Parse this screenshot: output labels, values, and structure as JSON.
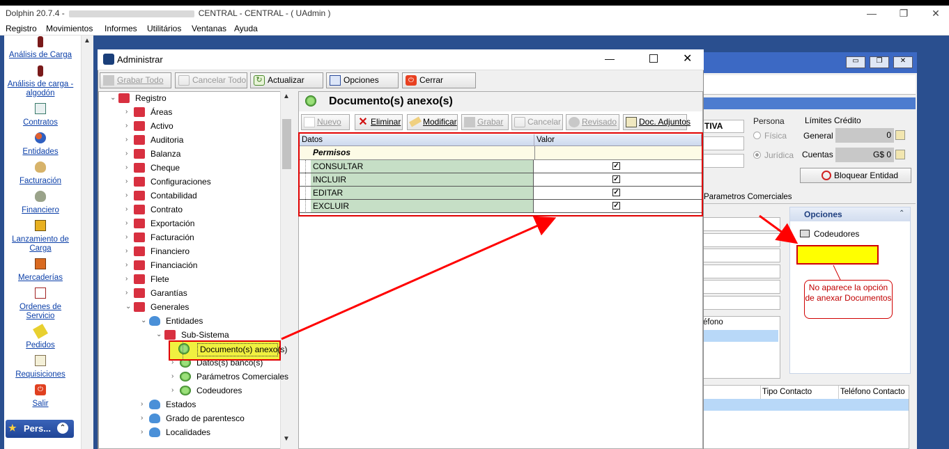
{
  "app": {
    "title_prefix": "Dolphin 20.7.4 -",
    "title_suffix": "CENTRAL - CENTRAL -  ( UAdmin )"
  },
  "menu": [
    "Registro",
    "Movimientos",
    "Informes",
    "Utilitários",
    "Ventanas",
    "Ayuda"
  ],
  "sidebar": {
    "items": [
      {
        "label": "Análisis de Carga",
        "icon": "bottle-icon"
      },
      {
        "label": "Análisis de carga - algodón",
        "icon": "bottle-icon"
      },
      {
        "label": "Contratos",
        "icon": "contract-icon"
      },
      {
        "label": "Entidades",
        "icon": "people-icon"
      },
      {
        "label": "Facturación",
        "icon": "money-bag-icon"
      },
      {
        "label": "Financiero",
        "icon": "money-bag-icon"
      },
      {
        "label": "Lanzamiento de Carga",
        "icon": "truck-icon"
      },
      {
        "label": "Mercaderías",
        "icon": "package-icon"
      },
      {
        "label": "Ordenes de Servicio",
        "icon": "order-icon"
      },
      {
        "label": "Pedidos",
        "icon": "pencil-icon"
      },
      {
        "label": "Requisiciones",
        "icon": "writing-icon"
      },
      {
        "label": "Salir",
        "icon": "exit-icon"
      }
    ],
    "group_label": "Pers..."
  },
  "dialog": {
    "title": "Administrar",
    "toolbar": {
      "grabar_todo": "Grabar Todo",
      "cancelar_todo": "Cancelar Todo",
      "actualizar": "Actualizar",
      "opciones": "Opciones",
      "cerrar": "Cerrar"
    },
    "tree": {
      "root": "Registro",
      "level1": [
        "Áreas",
        "Activo",
        "Auditoria",
        "Balanza",
        "Cheque",
        "Configuraciones",
        "Contabilidad",
        "Contrato",
        "Exportación",
        "Facturación",
        "Financiero",
        "Financiación",
        "Flete",
        "Garantías",
        "Generales"
      ],
      "entidades": "Entidades",
      "subsistema": "Sub-Sistema",
      "selected": "Documento(s) anexo(s)",
      "siblings": [
        "Datos(s) banco(s)",
        "Parámetros Comerciales",
        "Codeudores"
      ],
      "after": [
        "Estados",
        "Grado de parentesco",
        "Localidades"
      ]
    },
    "panel": {
      "title": "Documento(s) anexo(s)",
      "toolbar": {
        "nuevo": "Nuevo",
        "eliminar": "Eliminar",
        "modificar": "Modificar",
        "grabar": "Grabar",
        "cancelar": "Cancelar",
        "revisado": "Revisado",
        "doc_adjuntos": "Doc. Adjuntos"
      },
      "grid": {
        "columns": [
          "Datos",
          "Valor"
        ],
        "group": "Permisos",
        "rows": [
          {
            "name": "CONSULTAR",
            "checked": true
          },
          {
            "name": "INCLUIR",
            "checked": true
          },
          {
            "name": "EDITAR",
            "checked": true
          },
          {
            "name": "EXCLUIR",
            "checked": true
          }
        ]
      }
    }
  },
  "background_window": {
    "status_fragment": "TIVA",
    "persona_label": "Persona",
    "fisica": "Física",
    "juridica": "Jurídica",
    "limites_label": "Límites Crédito",
    "general_label": "General",
    "general_value": "0",
    "cuentas_label": "Cuentas",
    "cuentas_value": "G$ 0",
    "bloquear": "Bloquear Entidad",
    "tab_label": "Parametros Comerciales",
    "opciones_title": "Opciones",
    "codeudores": "Codeudores",
    "telefono_fragment": "éfono",
    "tipo_contacto": "Tipo Contacto",
    "telefono_contacto": "Teléfono Contacto"
  },
  "annotation": {
    "text": "No aparece la opción de anexar Documentos",
    "highlight_color": "#ffff00",
    "arrow_color": "#ff0000"
  }
}
